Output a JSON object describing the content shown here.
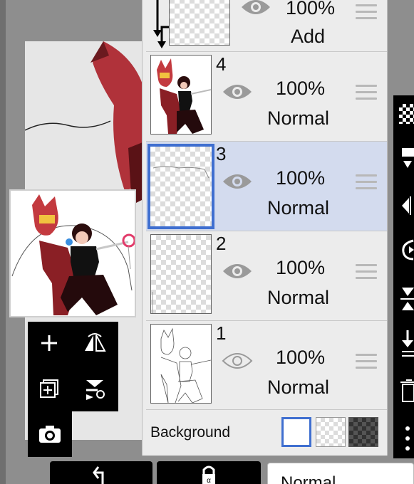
{
  "layers": [
    {
      "number": "",
      "opacity": "100%",
      "blend_mode": "Add"
    },
    {
      "number": "4",
      "opacity": "100%",
      "blend_mode": "Normal"
    },
    {
      "number": "3",
      "opacity": "100%",
      "blend_mode": "Normal"
    },
    {
      "number": "2",
      "opacity": "100%",
      "blend_mode": "Normal"
    },
    {
      "number": "1",
      "opacity": "100%",
      "blend_mode": "Normal"
    }
  ],
  "background": {
    "label": "Background"
  },
  "bottom_bar": {
    "blend_mode_value": "Normal"
  },
  "colors": {
    "selected_layer": "#d3dbee",
    "accent": "#3f6fd0",
    "panel": "#ececec"
  },
  "icons": [
    "clip-arrow-icon",
    "eye-icon",
    "reorder-handle-icon",
    "add-layer-icon",
    "flip-layer-icon",
    "copy-layer-icon",
    "merge-down-icon",
    "camera-icon",
    "checker-icon",
    "move-icon",
    "flip-icon",
    "rotate-icon",
    "merge-icon",
    "download-icon",
    "trash-icon",
    "undo-icon",
    "lock-icon"
  ]
}
